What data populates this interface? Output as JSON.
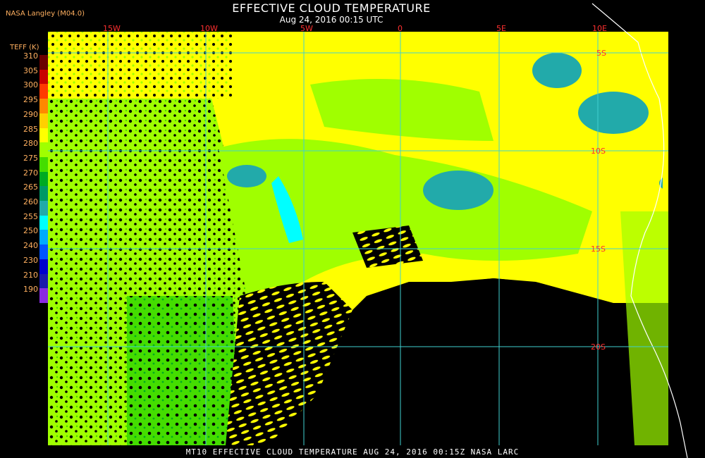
{
  "header": {
    "title": "EFFECTIVE CLOUD TEMPERATURE",
    "subtitle": "Aug 24, 2016 00:15 UTC",
    "producer": "NASA Langley (M04.0)"
  },
  "legend": {
    "title": "TEFF (K)",
    "labels": [
      "310",
      "305",
      "300",
      "295",
      "290",
      "285",
      "280",
      "275",
      "270",
      "265",
      "260",
      "255",
      "250",
      "240",
      "230",
      "210",
      "190"
    ],
    "colors": [
      "#6b0000",
      "#c80000",
      "#ff3a00",
      "#ff8800",
      "#ffd000",
      "#ffff00",
      "#a0ff00",
      "#44dd00",
      "#00aa22",
      "#009966",
      "#22aaaa",
      "#00ffff",
      "#00aaff",
      "#0055ff",
      "#0000cc",
      "#1a1aaa",
      "#8a2be2"
    ]
  },
  "grid": {
    "lon_labels": [
      "15W",
      "10W",
      "5W",
      "0",
      "5E",
      "10E"
    ],
    "lat_labels": [
      "5S",
      "10S",
      "15S",
      "20S"
    ]
  },
  "footer": {
    "text": "MT10  EFFECTIVE CLOUD TEMPERATURE   AUG 24, 2016 00:15Z   NASA LARC"
  },
  "colors": {
    "grid": "#40d0d0",
    "label": "#ff3030",
    "coast": "#ffffff",
    "clear": "#000000",
    "warm_cloud": "#ffff00",
    "mid_cloud": "#a0ff00",
    "cool_cloud": "#44dd00",
    "cold_cloud": "#22aaaa",
    "coldest_cloud": "#00ffff"
  }
}
